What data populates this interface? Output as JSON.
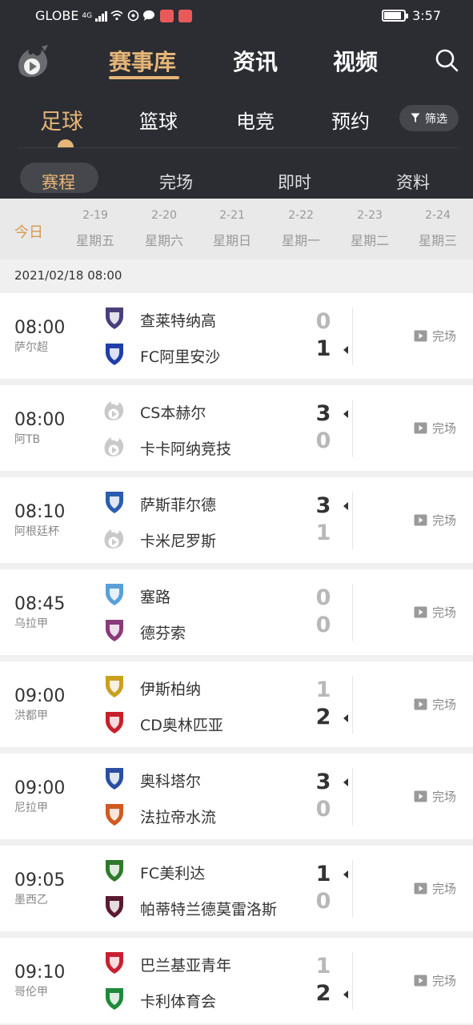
{
  "status_bar": {
    "carrier": "GLOBE",
    "network": "4G",
    "time": "3:57"
  },
  "header": {
    "nav": [
      {
        "label": "赛事库",
        "active": true
      },
      {
        "label": "资讯",
        "active": false
      },
      {
        "label": "视频",
        "active": false
      }
    ],
    "sports": [
      {
        "label": "足球",
        "active": true
      },
      {
        "label": "篮球",
        "active": false
      },
      {
        "label": "电竞",
        "active": false
      },
      {
        "label": "预约",
        "active": false
      }
    ],
    "filter_label": "筛选",
    "sub_tabs": [
      {
        "label": "赛程",
        "active": true
      },
      {
        "label": "完场",
        "active": false
      },
      {
        "label": "即时",
        "active": false
      },
      {
        "label": "资料",
        "active": false
      }
    ]
  },
  "date_bar": {
    "today_label": "今日",
    "days": [
      {
        "date": "2-19",
        "weekday": "星期五"
      },
      {
        "date": "2-20",
        "weekday": "星期六"
      },
      {
        "date": "2-21",
        "weekday": "星期日"
      },
      {
        "date": "2-22",
        "weekday": "星期一"
      },
      {
        "date": "2-23",
        "weekday": "星期二"
      },
      {
        "date": "2-24",
        "weekday": "星期三"
      }
    ]
  },
  "section_date": "2021/02/18 08:00",
  "matches": [
    {
      "time": "08:00",
      "league": "萨尔超",
      "home": "查莱特纳高",
      "away": "FC阿里安沙",
      "home_score": "0",
      "away_score": "1",
      "winner": "away",
      "status": "完场",
      "home_crest": "#4a3f7a",
      "away_crest": "#1e3fa8"
    },
    {
      "time": "08:00",
      "league": "阿TB",
      "home": "CS本赫尔",
      "away": "卡卡阿纳竞技",
      "home_score": "3",
      "away_score": "0",
      "winner": "home",
      "status": "完场",
      "home_crest": "placeholder",
      "away_crest": "placeholder"
    },
    {
      "time": "08:10",
      "league": "阿根廷杯",
      "home": "萨斯菲尔德",
      "away": "卡米尼罗斯",
      "home_score": "3",
      "away_score": "1",
      "winner": "home",
      "status": "完场",
      "home_crest": "#2a5db0",
      "away_crest": "placeholder"
    },
    {
      "time": "08:45",
      "league": "乌拉甲",
      "home": "塞路",
      "away": "德芬索",
      "home_score": "0",
      "away_score": "0",
      "winner": "none",
      "status": "完场",
      "home_crest": "#5aa0d8",
      "away_crest": "#8a3a7a"
    },
    {
      "time": "09:00",
      "league": "洪都甲",
      "home": "伊斯柏纳",
      "away": "CD奥林匹亚",
      "home_score": "1",
      "away_score": "2",
      "winner": "away",
      "status": "完场",
      "home_crest": "#c9a020",
      "away_crest": "#c8202a"
    },
    {
      "time": "09:00",
      "league": "尼拉甲",
      "home": "奥科塔尔",
      "away": "法拉帝水流",
      "home_score": "3",
      "away_score": "0",
      "winner": "home",
      "status": "完场",
      "home_crest": "#2a4fa0",
      "away_crest": "#d05a20"
    },
    {
      "time": "09:05",
      "league": "墨西乙",
      "home": "FC美利达",
      "away": "帕蒂特兰德莫雷洛斯",
      "home_score": "1",
      "away_score": "0",
      "winner": "home",
      "status": "完场",
      "home_crest": "#2f7a2a",
      "away_crest": "#5a1a30"
    },
    {
      "time": "09:10",
      "league": "哥伦甲",
      "home": "巴兰基亚青年",
      "away": "卡利体育会",
      "home_score": "1",
      "away_score": "2",
      "winner": "away",
      "status": "完场",
      "home_crest": "#c82030",
      "away_crest": "#1f8a3a"
    }
  ]
}
